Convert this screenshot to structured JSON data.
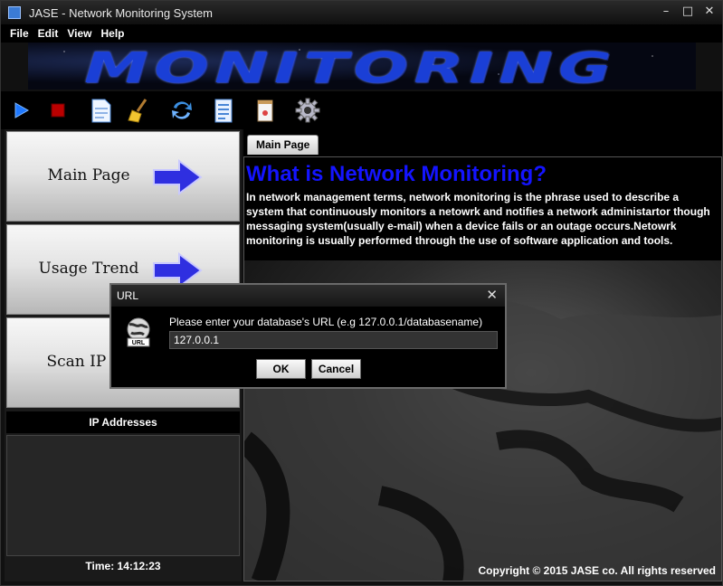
{
  "window": {
    "title": "JASE - Network Monitoring System"
  },
  "menu": [
    "File",
    "Edit",
    "View",
    "Help"
  ],
  "banner": {
    "text": "MONITORING"
  },
  "toolbar": {
    "icons": [
      "play-icon",
      "stop-icon",
      "document-icon",
      "broom-icon",
      "refresh-icon",
      "clipboard-icon",
      "notepad-icon",
      "gear-icon"
    ]
  },
  "sidebar": {
    "nav": [
      {
        "label": "Main Page"
      },
      {
        "label": "Usage Trend"
      },
      {
        "label": "Scan IP Ac"
      }
    ],
    "ip_header": "IP Addresses",
    "time": "Time: 14:12:23"
  },
  "main": {
    "tab": "Main Page",
    "heading": "What is Network Monitoring?",
    "paragraph": "In network management terms, network monitoring is the phrase used to describe a system that continuously monitors a netowrk and notifies a network administartor though messaging system(usually e-mail) when a device fails or an outage occurs.Netowrk monitoring is usually performed through the use of software application and tools.",
    "copyright": "Copyright © 2015 JASE co.  All rights reserved"
  },
  "dialog": {
    "title": "URL",
    "message": "Please enter your database's URL (e.g 127.0.0.1/databasename)",
    "input_value": "127.0.0.1",
    "ok": "OK",
    "cancel": "Cancel",
    "icon_label": "URL"
  },
  "colors": {
    "heading": "#1414ff",
    "banner_text": "#1a3fd6",
    "arrow": "#2f2fe0"
  }
}
